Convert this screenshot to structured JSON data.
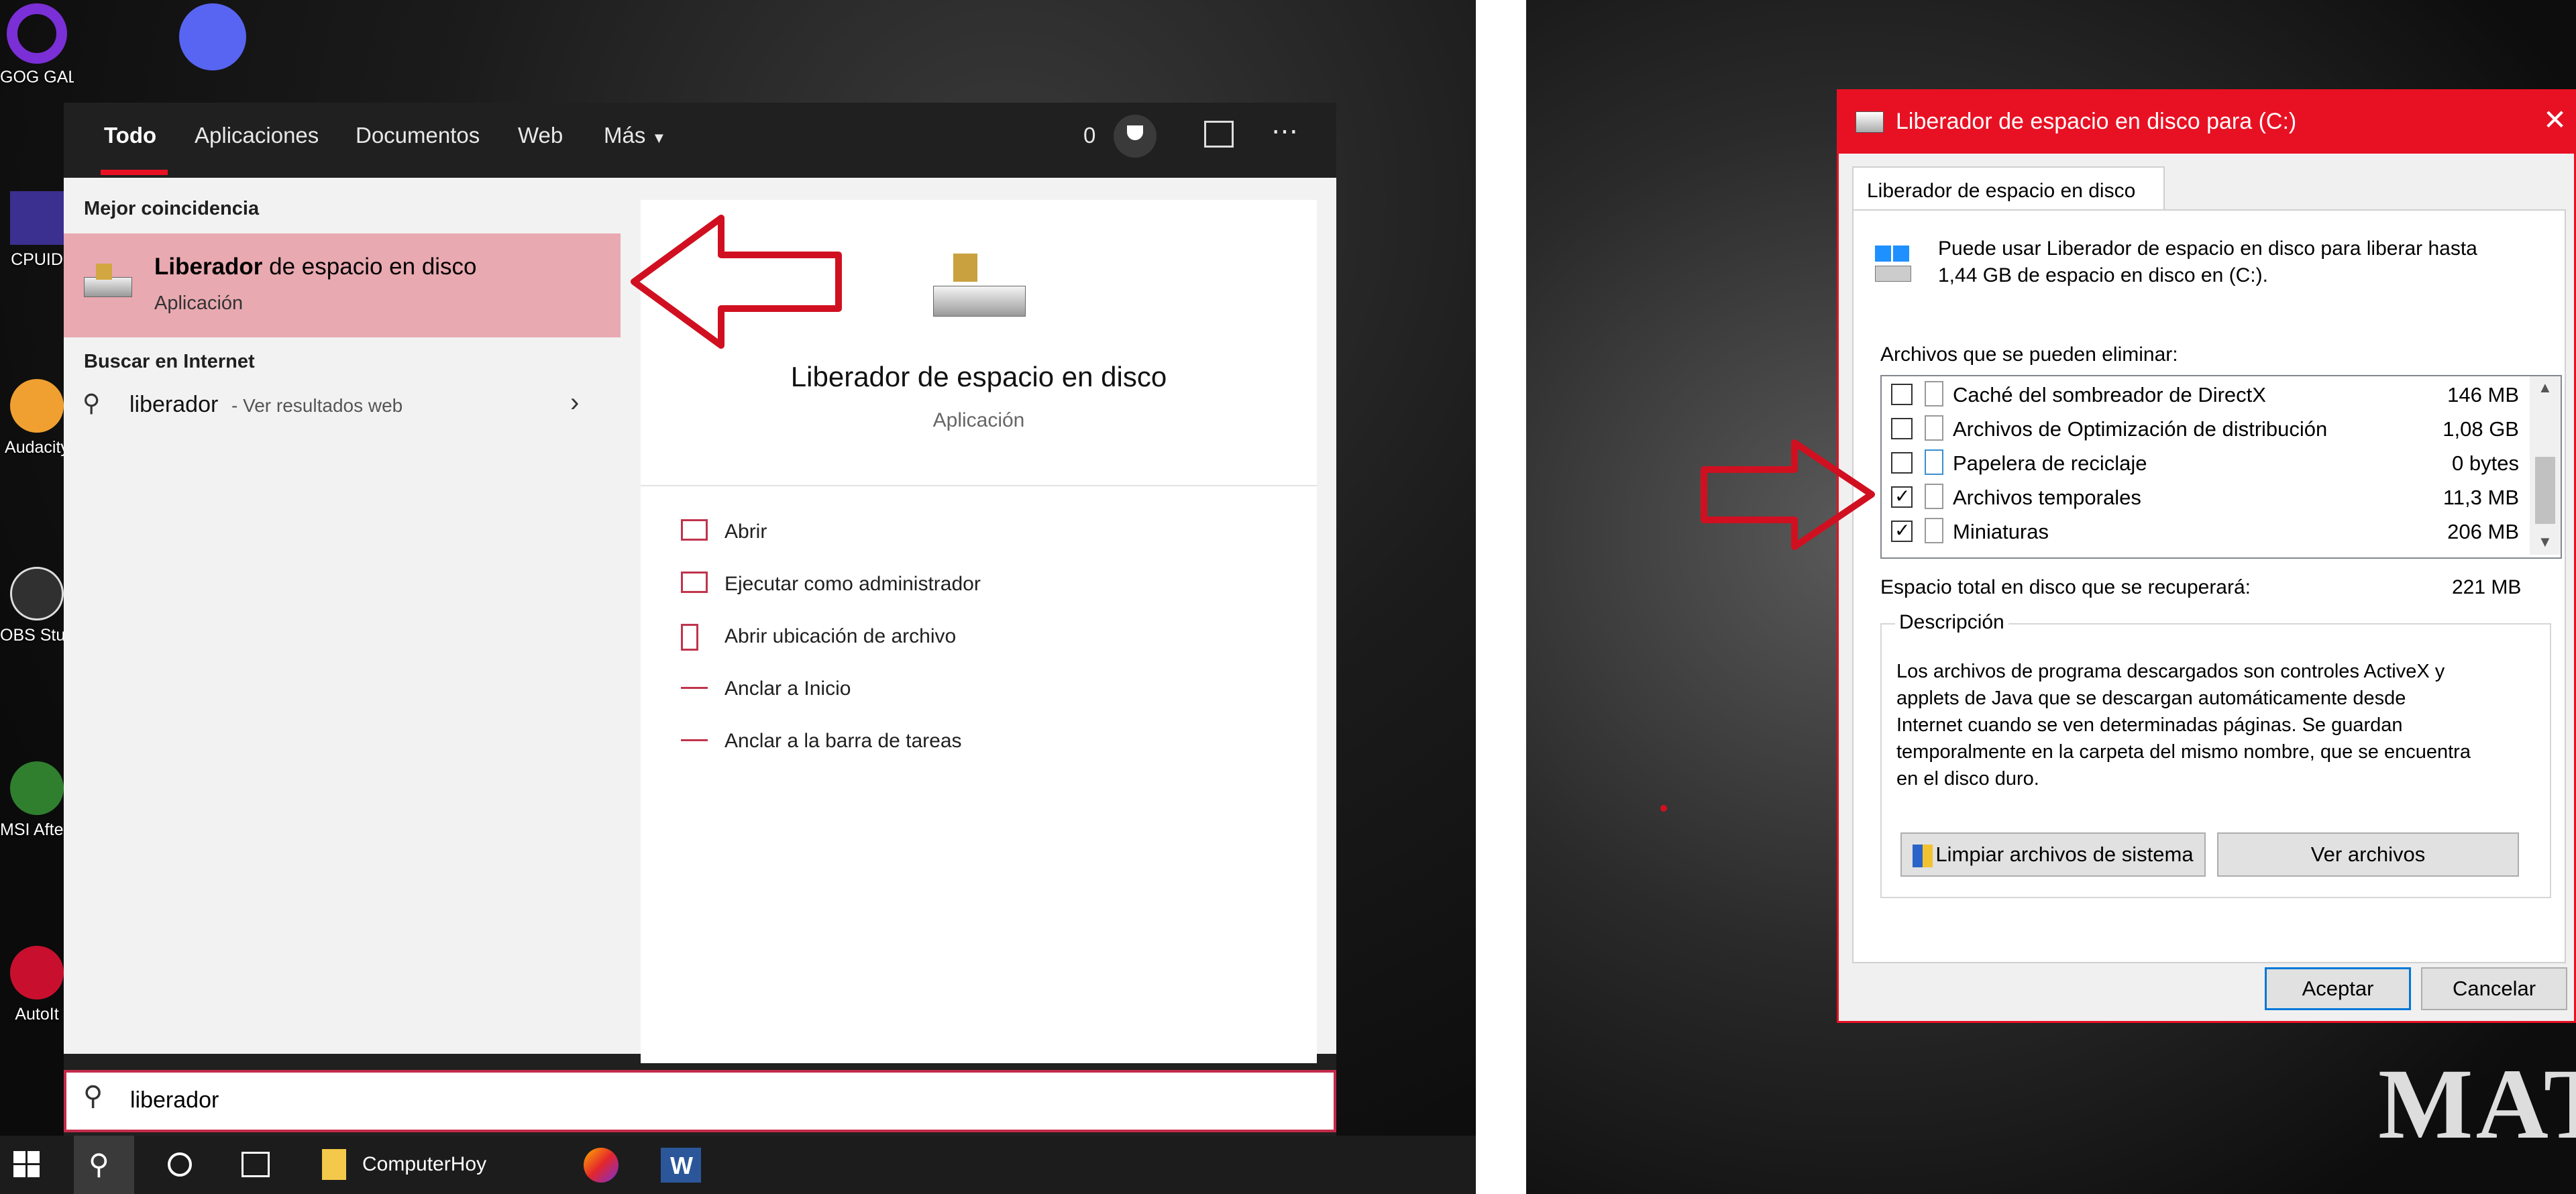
{
  "desktop": {
    "icons": [
      {
        "label": "GOG GALAXY"
      },
      {
        "label": "Discord"
      },
      {
        "label": "CPUID"
      },
      {
        "label": "Audacity"
      },
      {
        "label": "OBS Studio"
      },
      {
        "label": "MSI Afterburner"
      },
      {
        "label": "AutoIt"
      }
    ]
  },
  "search": {
    "tabs": [
      "Todo",
      "Aplicaciones",
      "Documentos",
      "Web",
      "Más"
    ],
    "points": "0",
    "best_match_heading": "Mejor coincidencia",
    "best_match": {
      "title_bold": "Liberador",
      "title_rest": " de espacio en disco",
      "subtitle": "Aplicación"
    },
    "internet_heading": "Buscar en Internet",
    "web_query": "liberador",
    "web_suffix": " - Ver resultados web",
    "preview": {
      "title": "Liberador de espacio en disco",
      "subtitle": "Aplicación",
      "actions": [
        "Abrir",
        "Ejecutar como administrador",
        "Abrir ubicación de archivo",
        "Anclar a Inicio",
        "Anclar a la barra de tareas"
      ]
    },
    "query": "liberador"
  },
  "taskbar": {
    "folder_label": "ComputerHoy"
  },
  "dialog": {
    "title": "Liberador de espacio en disco para  (C:)",
    "tab": "Liberador de espacio en disco",
    "intro_line1": "Puede usar Liberador de espacio en disco para liberar hasta",
    "intro_line2": "1,44 GB de espacio en disco en  (C:).",
    "files_label": "Archivos que se pueden eliminar:",
    "files": [
      {
        "name": "Caché del sombreador de DirectX",
        "size": "146 MB",
        "checked": false
      },
      {
        "name": "Archivos de Optimización de distribución",
        "size": "1,08 GB",
        "checked": false
      },
      {
        "name": "Papelera de reciclaje",
        "size": "0 bytes",
        "checked": false
      },
      {
        "name": "Archivos temporales",
        "size": "11,3 MB",
        "checked": true
      },
      {
        "name": "Miniaturas",
        "size": "206 MB",
        "checked": true
      }
    ],
    "total_label": "Espacio total en disco que se recuperará:",
    "total_value": "221 MB",
    "description_label": "Descripción",
    "description_lines": [
      "Los archivos de programa descargados son controles ActiveX y",
      "applets de Java que se descargan automáticamente desde",
      "Internet cuando se ven determinadas páginas. Se guardan",
      "temporalmente en la carpeta del mismo nombre, que se encuentra",
      "en el disco duro."
    ],
    "btn_clean_system": "Limpiar archivos de sistema",
    "btn_view_files": "Ver archivos",
    "btn_ok": "Aceptar",
    "btn_cancel": "Cancelar"
  },
  "colors": {
    "accent_red": "#e81123",
    "highlight_pink": "#e9a9b1"
  }
}
